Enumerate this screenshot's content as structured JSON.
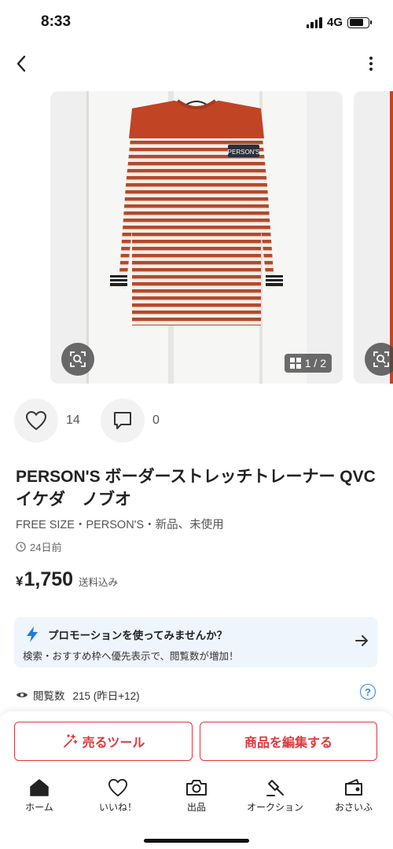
{
  "status_bar": {
    "time": "8:33",
    "network": "4G"
  },
  "product": {
    "image_counter": "1 / 2",
    "likes": "14",
    "comments": "0",
    "title": "PERSON'S ボーダーストレッチトレーナー QVC イケダ　ノブオ",
    "meta": "FREE SIZE・PERSON'S・新品、未使用",
    "posted": "24日前",
    "price_symbol": "¥",
    "price": "1,750",
    "shipping": "送料込み",
    "shirt_logo": "PERSON'S"
  },
  "promo": {
    "title": "プロモーションを使ってみませんか？",
    "desc": "検索・おすすめ枠へ優先表示で、閲覧数が増加！"
  },
  "stats": {
    "views_label": "閲覧数",
    "views_value": "215 (昨日+12)",
    "help": "?"
  },
  "actions": {
    "sell_tools": "売るツール",
    "edit": "商品を編集する"
  },
  "tabs": [
    {
      "label": "ホーム",
      "icon": "home-icon"
    },
    {
      "label": "いいね！",
      "icon": "heart-icon"
    },
    {
      "label": "出品",
      "icon": "camera-icon"
    },
    {
      "label": "オークション",
      "icon": "gavel-icon"
    },
    {
      "label": "おさいふ",
      "icon": "wallet-icon"
    }
  ],
  "colors": {
    "accent": "#e0373a",
    "link": "#2a8ae5",
    "promo_bg": "#eef5fc"
  }
}
